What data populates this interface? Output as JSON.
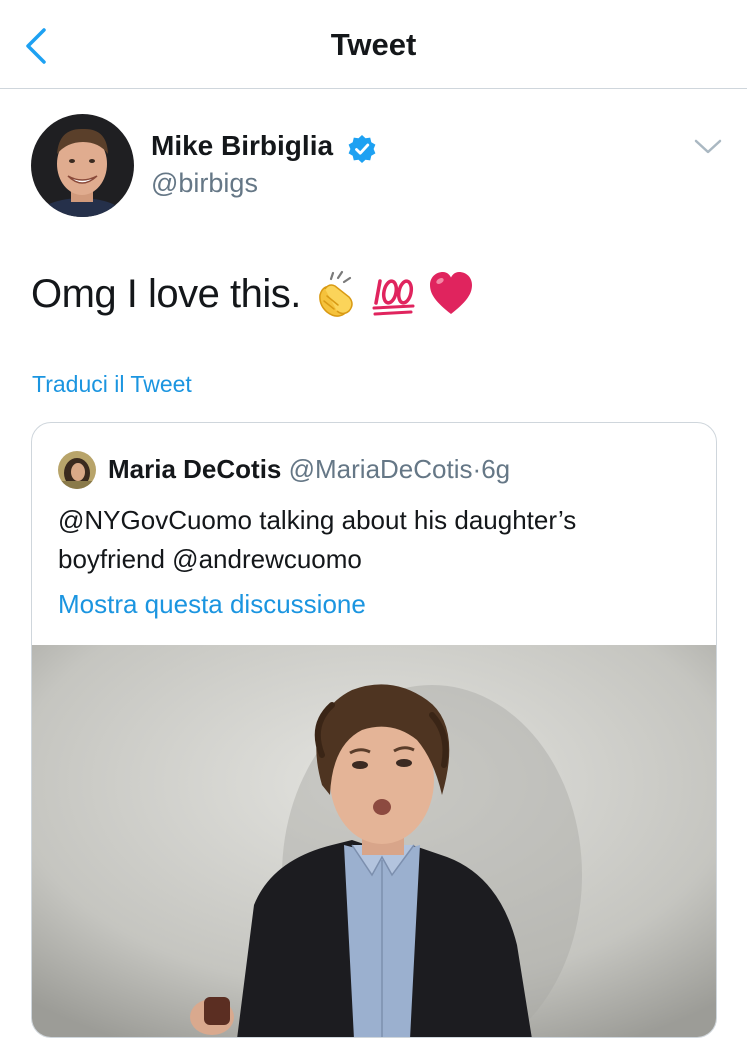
{
  "header": {
    "title": "Tweet",
    "back_icon": "chevron-left-icon",
    "accent_color": "#1da1f2"
  },
  "tweet": {
    "author_name": "Mike Birbiglia",
    "author_handle": "@birbigs",
    "verified": true,
    "text": "Omg I love this.",
    "emojis": [
      "clapping-hands-emoji",
      "hundred-points-emoji",
      "red-heart-emoji"
    ],
    "translate_label": "Traduci il Tweet"
  },
  "quoted_tweet": {
    "author_name": "Maria DeCotis",
    "author_handle": "@MariaDeCotis",
    "separator": "·",
    "time": "6g",
    "text": "@NYGovCuomo talking about his daughter’s boyfriend @andrewcuomo",
    "thread_label": "Mostra questa discussione",
    "media": "video-thumbnail"
  },
  "colors": {
    "link": "#1b95e0",
    "secondary_text": "#657786",
    "divider": "#cfd6dc",
    "verified_badge": "#1da1f2"
  }
}
